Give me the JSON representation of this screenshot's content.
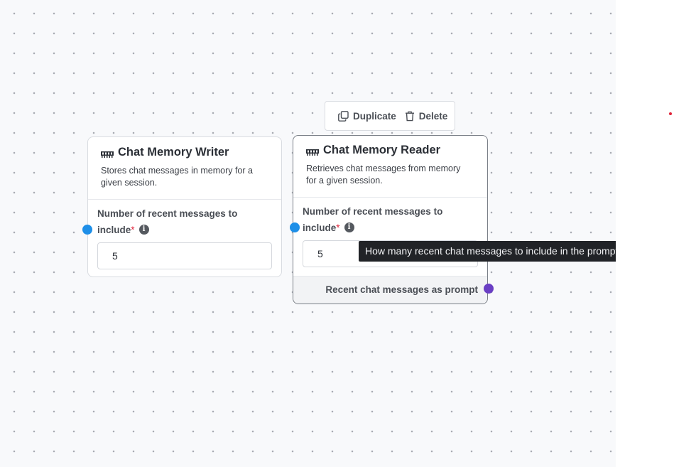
{
  "toolbar": {
    "duplicate_label": "Duplicate",
    "delete_label": "Delete"
  },
  "writer_node": {
    "title": "Chat Memory Writer",
    "description": "Stores chat messages in memory for a given session.",
    "field_label": "Number of recent messages to include",
    "required_mark": "*",
    "info_glyph": "i",
    "input_value": "5"
  },
  "reader_node": {
    "title": "Chat Memory Reader",
    "description": "Retrieves chat messages from memory for a given session.",
    "field_label": "Number of recent messages to include",
    "required_mark": "*",
    "info_glyph": "i",
    "input_value": "5",
    "output_label": "Recent chat messages as prompt"
  },
  "tooltip": {
    "text": "How many recent chat messages to include in the prompt."
  },
  "icons": {
    "node_icon": "ram-memory-icon",
    "duplicate_icon": "copy-icon",
    "delete_icon": "trash-icon",
    "info_icon": "info-icon"
  },
  "colors": {
    "input_handle": "#1e8fe8",
    "output_handle": "#6a3fc4",
    "required": "#e0243a",
    "tooltip_bg": "#212327"
  }
}
